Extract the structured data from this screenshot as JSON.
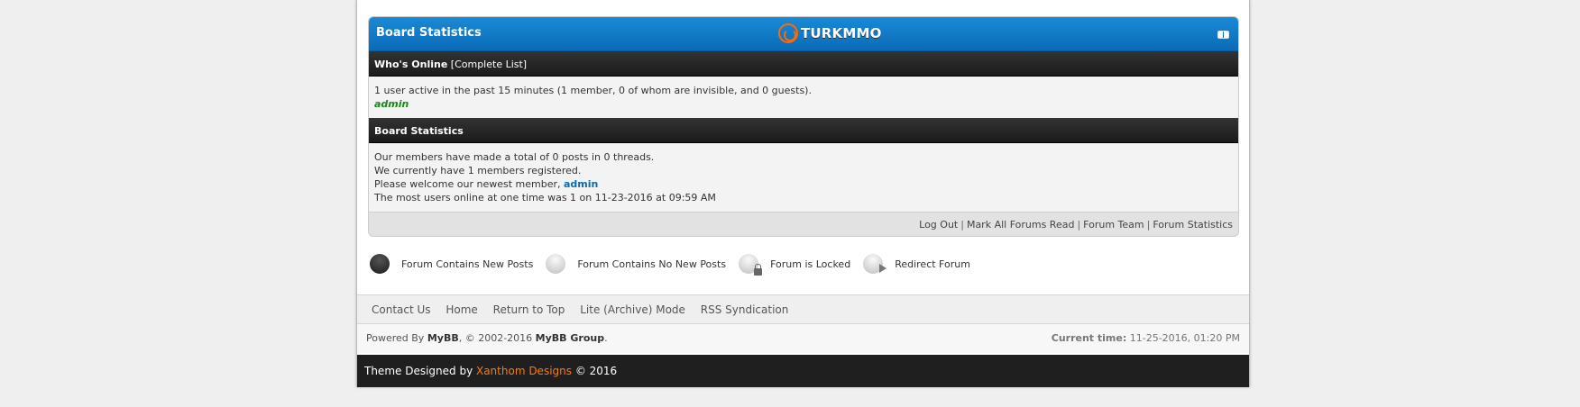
{
  "board_stats": {
    "title": "Board Statistics",
    "logo_text": "TURKMMO",
    "whos_online": {
      "heading": "Who's Online",
      "complete_list": "[Complete List]",
      "summary": "1 user active in the past 15 minutes (1 member, 0 of whom are invisible, and 0 guests).",
      "online_user": "admin"
    },
    "statistics": {
      "heading": "Board Statistics",
      "posts_line": "Our members have made a total of 0 posts in 0 threads.",
      "members_line": "We currently have 1 members registered.",
      "welcome_prefix": "Please welcome our newest member, ",
      "newest_member": "admin",
      "most_online_line": "The most users online at one time was 1 on 11-23-2016 at 09:59 AM"
    },
    "footer_links": [
      "Log Out",
      "Mark All Forums Read",
      "Forum Team",
      "Forum Statistics"
    ]
  },
  "legend": [
    {
      "label": "Forum Contains New Posts",
      "icon": "forum-new-posts-icon"
    },
    {
      "label": "Forum Contains No New Posts",
      "icon": "forum-no-new-posts-icon"
    },
    {
      "label": "Forum is Locked",
      "icon": "forum-locked-icon"
    },
    {
      "label": "Redirect Forum",
      "icon": "forum-redirect-icon"
    }
  ],
  "footer_nav": [
    "Contact Us",
    "Home",
    "Return to Top",
    "Lite (Archive) Mode",
    "RSS Syndication"
  ],
  "copyright": {
    "powered_by": "Powered By ",
    "mybb": "MyBB",
    "years": ", © 2002-2016 ",
    "group": "MyBB Group",
    "period": ".",
    "current_time_label": "Current time:",
    "current_time_value": " 11-25-2016, 01:20 PM"
  },
  "designed_by": {
    "prefix": "Theme Designed by ",
    "name": "Xanthom Designs",
    "suffix": " © 2016"
  },
  "colors": {
    "header_blue": "#0a6bb7",
    "brand_orange": "#ff6a00",
    "online_green": "#168a16",
    "dark_bar": "#1f1f1f"
  }
}
